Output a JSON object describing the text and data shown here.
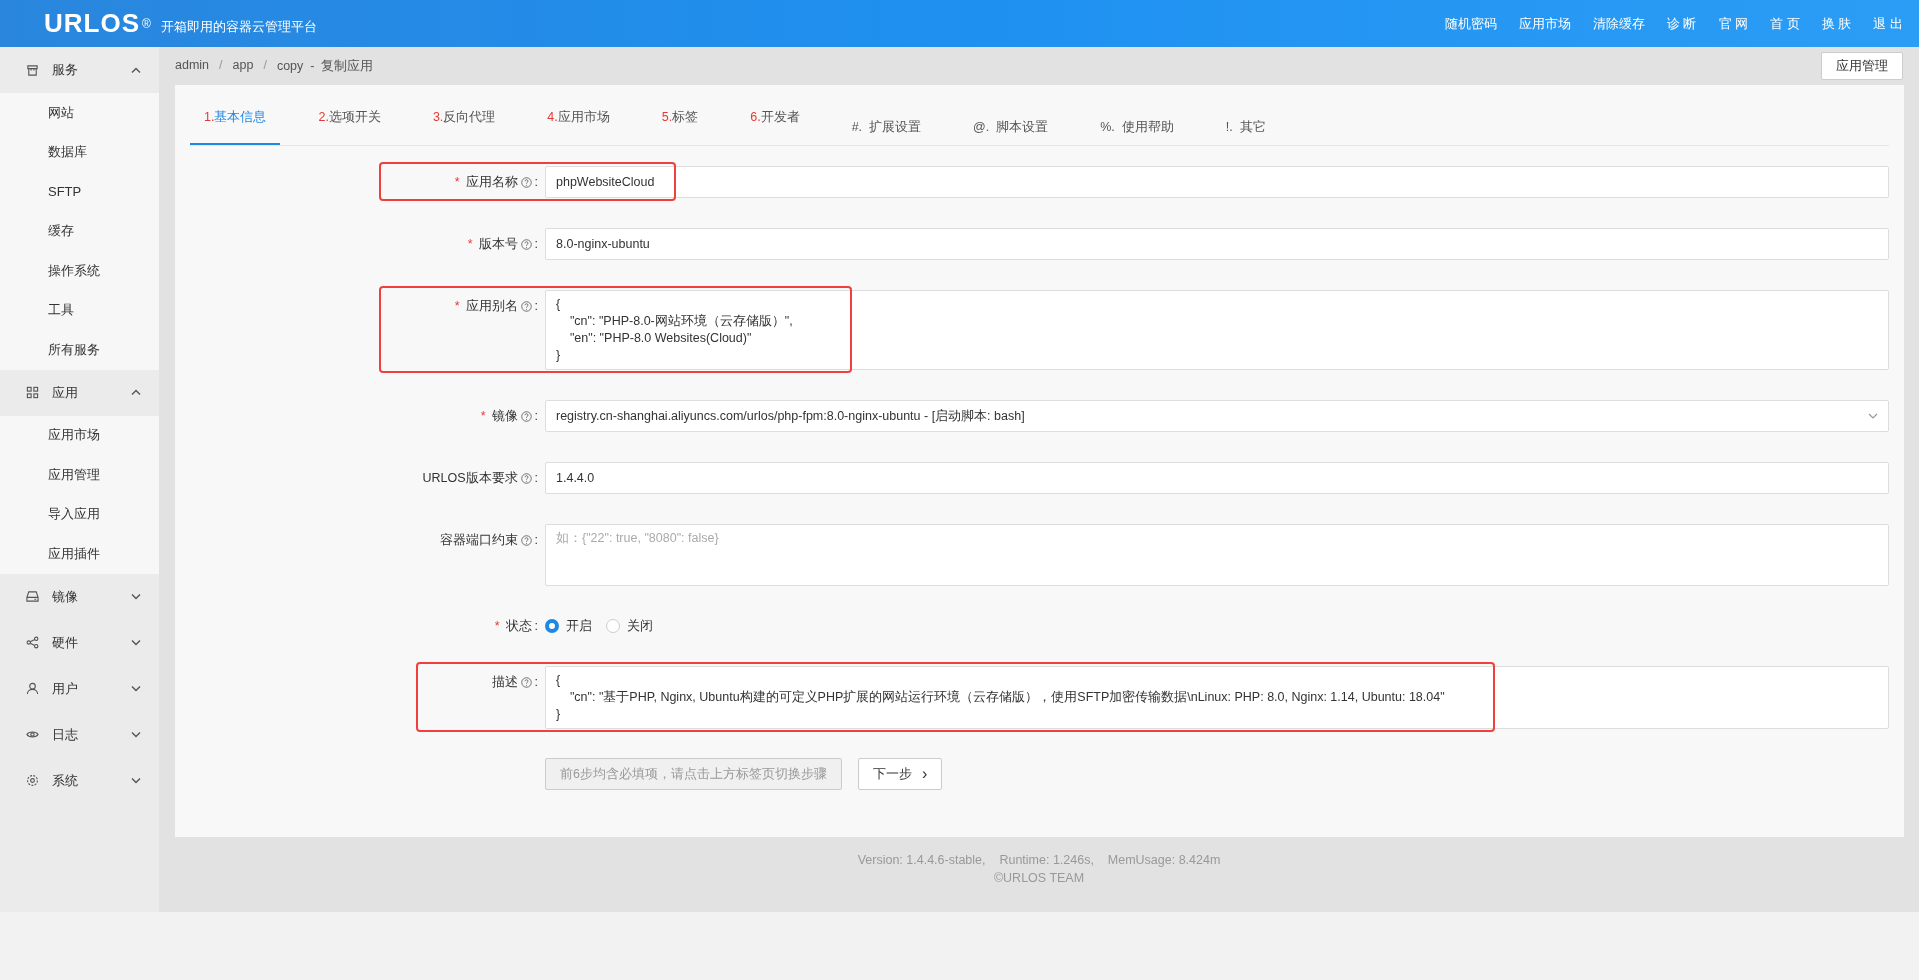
{
  "header": {
    "logo": "URLOS",
    "logo_mark": "®",
    "subtitle": "开箱即用的容器云管理平台",
    "nav": [
      "随机密码",
      "应用市场",
      "清除缓存",
      "诊 断",
      "官 网",
      "首 页",
      "换 肤",
      "退 出"
    ]
  },
  "sidebar": [
    {
      "label": "服务",
      "kind": "store",
      "expanded": true,
      "children": [
        {
          "label": "网站"
        },
        {
          "label": "数据库"
        },
        {
          "label": "SFTP"
        },
        {
          "label": "缓存"
        },
        {
          "label": "操作系统"
        },
        {
          "label": "工具"
        },
        {
          "label": "所有服务"
        }
      ]
    },
    {
      "label": "应用",
      "kind": "grid",
      "expanded": true,
      "children": [
        {
          "label": "应用市场"
        },
        {
          "label": "应用管理"
        },
        {
          "label": "导入应用"
        },
        {
          "label": "应用插件"
        }
      ]
    },
    {
      "label": "镜像",
      "kind": "drive",
      "expanded": false
    },
    {
      "label": "硬件",
      "kind": "share",
      "expanded": false
    },
    {
      "label": "用户",
      "kind": "user",
      "expanded": false
    },
    {
      "label": "日志",
      "kind": "eye",
      "expanded": false
    },
    {
      "label": "系统",
      "kind": "gear",
      "expanded": false
    }
  ],
  "breadcrumb": [
    {
      "kind": "link",
      "text": "admin"
    },
    {
      "kind": "separator",
      "text": "/"
    },
    {
      "kind": "link",
      "text": "app"
    },
    {
      "kind": "separator",
      "text": "/"
    },
    {
      "kind": "current",
      "text": "copy  -  复制应用"
    }
  ],
  "action_button": "应用管理",
  "tabs": [
    {
      "number": "1.",
      "label": "基本信息",
      "required": true,
      "selected": true
    },
    {
      "number": "2.",
      "label": "选项开关",
      "required": true,
      "selected": false
    },
    {
      "number": "3.",
      "label": "反向代理",
      "required": true,
      "selected": false
    },
    {
      "number": "4.",
      "label": "应用市场",
      "required": true,
      "selected": false
    },
    {
      "number": "5.",
      "label": "标签",
      "required": true,
      "selected": false
    },
    {
      "number": "6.",
      "label": "开发者",
      "required": true,
      "selected": false
    },
    {
      "number": "#.",
      "label": "扩展设置",
      "required": false,
      "selected": false
    },
    {
      "number": "@.",
      "label": "脚本设置",
      "required": false,
      "selected": false
    },
    {
      "number": "%.",
      "label": "使用帮助",
      "required": false,
      "selected": false
    },
    {
      "number": "!.",
      "label": "其它",
      "required": false,
      "selected": false
    }
  ],
  "fields": [
    {
      "kind": "input",
      "required_mark": "*",
      "label": "应用名称",
      "help": true,
      "colon": ":",
      "value": "phpWebsiteCloud",
      "highlighted": true
    },
    {
      "kind": "input",
      "required_mark": "*",
      "label": "版本号",
      "help": true,
      "colon": ":",
      "value": "8.0-nginx-ubuntu",
      "highlighted": false
    },
    {
      "kind": "textarea",
      "required_mark": "*",
      "label": "应用别名",
      "help": true,
      "colon": ":",
      "value": "{\n    \"cn\": \"PHP-8.0-网站环境（云存储版）\",\n    \"en\": \"PHP-8.0 Websites(Cloud)\"\n}",
      "highlighted": true
    },
    {
      "kind": "select",
      "required_mark": "*",
      "label": "镜像",
      "help": true,
      "colon": ":",
      "value": "registry.cn-shanghai.aliyuncs.com/urlos/php-fpm:8.0-nginx-ubuntu - [启动脚本: bash]",
      "highlighted": false
    },
    {
      "kind": "input",
      "label": "URLOS版本要求",
      "help": true,
      "colon": ":",
      "value": "1.4.4.0",
      "highlighted": false
    },
    {
      "kind": "textarea",
      "label": "容器端口约束",
      "help": true,
      "colon": ":",
      "placeholder": "如：{\"22\": true, \"8080\": false}",
      "highlighted": false
    },
    {
      "kind": "radio",
      "required_mark": "*",
      "label": "状态",
      "help": false,
      "colon": ":",
      "options": [
        {
          "label": "开启",
          "selected": true
        },
        {
          "label": "关闭",
          "selected": false
        }
      ],
      "highlighted": false
    },
    {
      "kind": "textarea",
      "label": "描述",
      "help": true,
      "colon": ":",
      "value": "{\n    \"cn\": \"基于PHP, Nginx, Ubuntu构建的可定义PHP扩展的网站运行环境（云存储版），使用SFTP加密传输数据\\nLinux: PHP: 8.0, Nginx: 1.14, Ubuntu: 18.04\"\n}",
      "highlighted": true
    }
  ],
  "buttons": [
    {
      "label": "前6步均含必填项，请点击上方标签页切换步骤",
      "disabled": true
    },
    {
      "label": "下一步",
      "caret": "›",
      "disabled": false
    }
  ],
  "footer": [
    "Version: 1.4.4.6-stable,    Runtime: 1.246s,    MemUsage: 8.424m",
    "©URLOS TEAM"
  ]
}
